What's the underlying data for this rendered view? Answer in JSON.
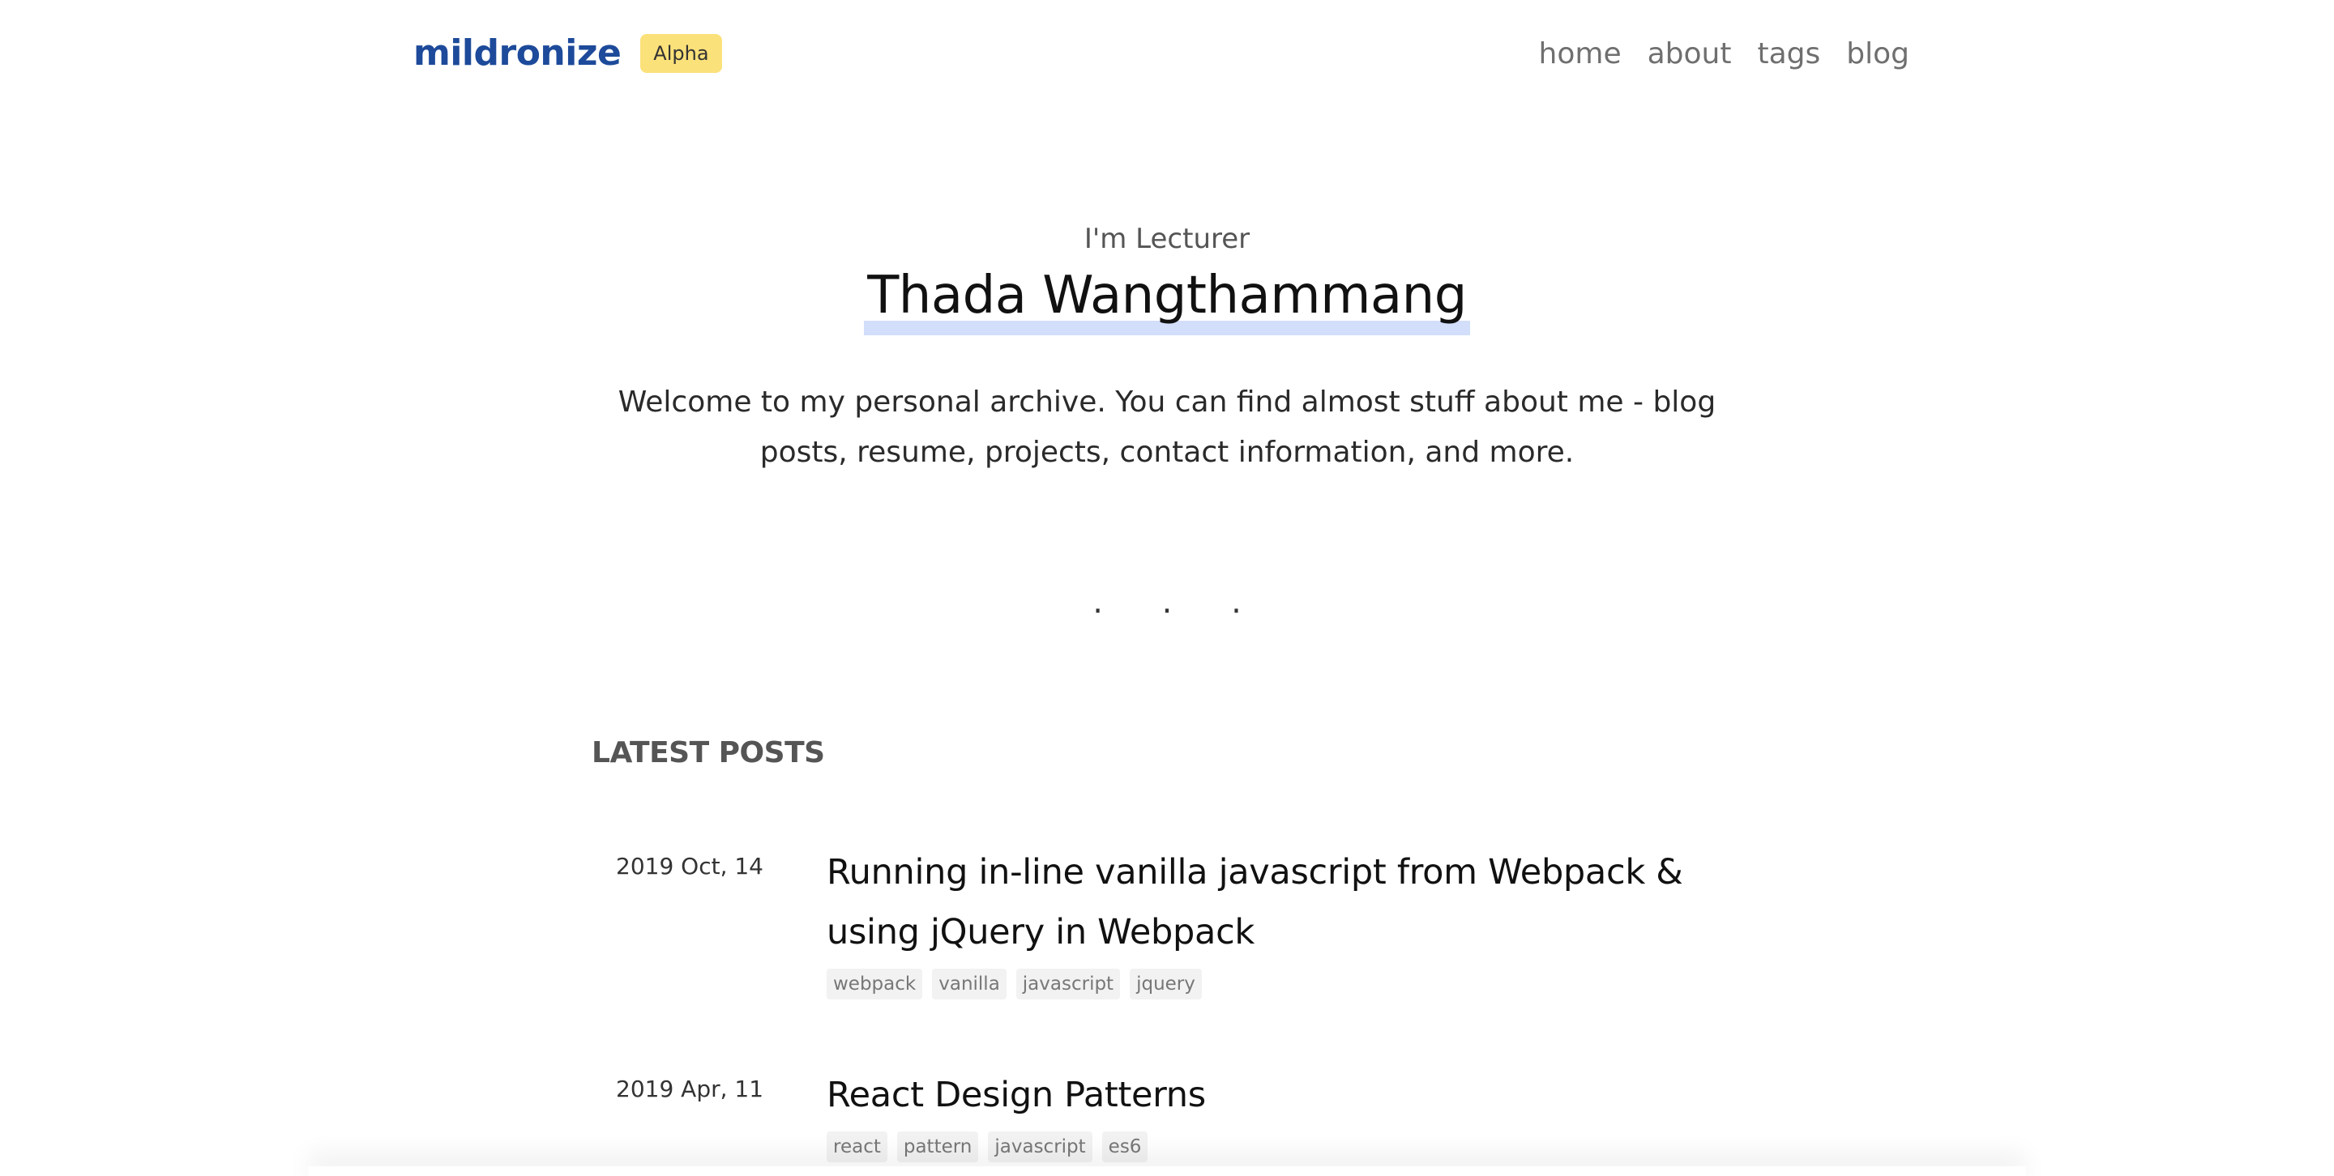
{
  "header": {
    "brand": "mildronize",
    "badge": "Alpha",
    "nav": [
      "home",
      "about",
      "tags",
      "blog"
    ]
  },
  "hero": {
    "role": "I'm Lecturer",
    "name": "Thada Wangthammang",
    "intro": "Welcome to my personal archive. You can find almost stuff about me - blog posts, resume, projects, contact information, and more."
  },
  "divider": "· · ·",
  "latest": {
    "title": "LATEST POSTS",
    "posts": [
      {
        "date": "2019 Oct, 14",
        "title": "Running in-line vanilla javascript from Webpack & using jQuery in Webpack",
        "tags": [
          "webpack",
          "vanilla",
          "javascript",
          "jquery"
        ]
      },
      {
        "date": "2019 Apr, 11",
        "title": "React Design Patterns",
        "tags": [
          "react",
          "pattern",
          "javascript",
          "es6"
        ]
      }
    ]
  },
  "colors": {
    "brand": "#1d4a9a",
    "badge": "#fbe17a",
    "underline": "#d2defa",
    "nav": "#6f6f6f"
  }
}
